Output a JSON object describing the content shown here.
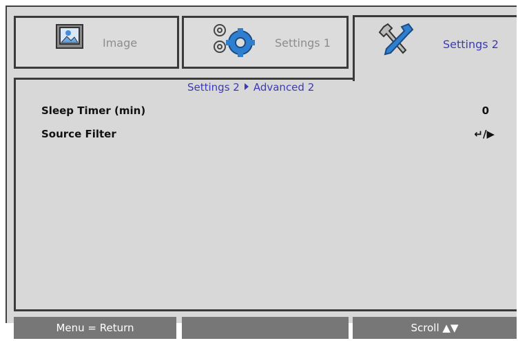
{
  "tabs": [
    {
      "label": "Image",
      "icon": "image-icon",
      "selected": false
    },
    {
      "label": "Settings 1",
      "icon": "gears-icon",
      "selected": false
    },
    {
      "label": "Settings 2",
      "icon": "tools-icon",
      "selected": true
    }
  ],
  "breadcrumb": {
    "parent": "Settings 2",
    "current": "Advanced 2"
  },
  "rows": [
    {
      "label": "Sleep Timer (min)",
      "value": "0"
    },
    {
      "label": "Source Filter",
      "value": "↵/▶"
    }
  ],
  "footer": {
    "left": "Menu = Return",
    "middle": "",
    "right": "Scroll ▲▼"
  },
  "colors": {
    "accent": "#3a3ab8",
    "panel": "#d8d8d8",
    "footer": "#777777"
  }
}
